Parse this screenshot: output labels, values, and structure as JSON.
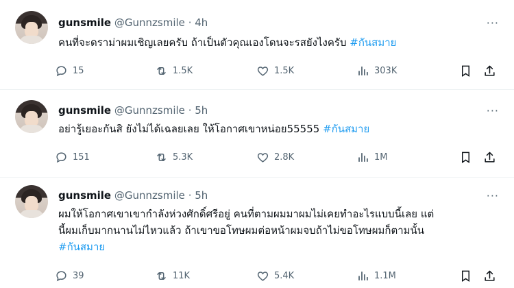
{
  "tweets": [
    {
      "name": "gunsmile",
      "handle": "@Gunnzsmile",
      "dot": "·",
      "time": "4h",
      "text": "คนที่จะดราม่าผมเชิญเลยครับ ถ้าเป็นตัวคุณเองโดนจะรสยังไงครับ",
      "hashtag": "#กันสมาย",
      "replies": "15",
      "retweets": "1.5K",
      "likes": "1.5K",
      "views": "303K"
    },
    {
      "name": "gunsmile",
      "handle": "@Gunnzsmile",
      "dot": "·",
      "time": "5h",
      "text": "อย่ารู้เยอะกันสิ ยังไม่ได้เฉลยเลย ให้โอกาศเขาหน่อย55555",
      "hashtag": "#กันสมาย",
      "replies": "151",
      "retweets": "5.3K",
      "likes": "2.8K",
      "views": "1M"
    },
    {
      "name": "gunsmile",
      "handle": "@Gunnzsmile",
      "dot": "·",
      "time": "5h",
      "text_line1": "ผมให้โอกาศเขาเขากำลังห่วงศักดิ์ศรีอยู่ คนที่ตามผมมาผมไม่เคยทำอะไรแบบนี้เลย แต่",
      "text_line2": "นี้ผมเก็บมากนานไม่ไหวแล้ว ถ้าเขาขอโทษผมต่อหน้าผมจบถ้าไม่ขอโทษผมก็ตามนั้น",
      "hashtag": "#กันสมาย",
      "replies": "39",
      "retweets": "11K",
      "likes": "5.4K",
      "views": "1.1M"
    }
  ],
  "more_label": "···"
}
